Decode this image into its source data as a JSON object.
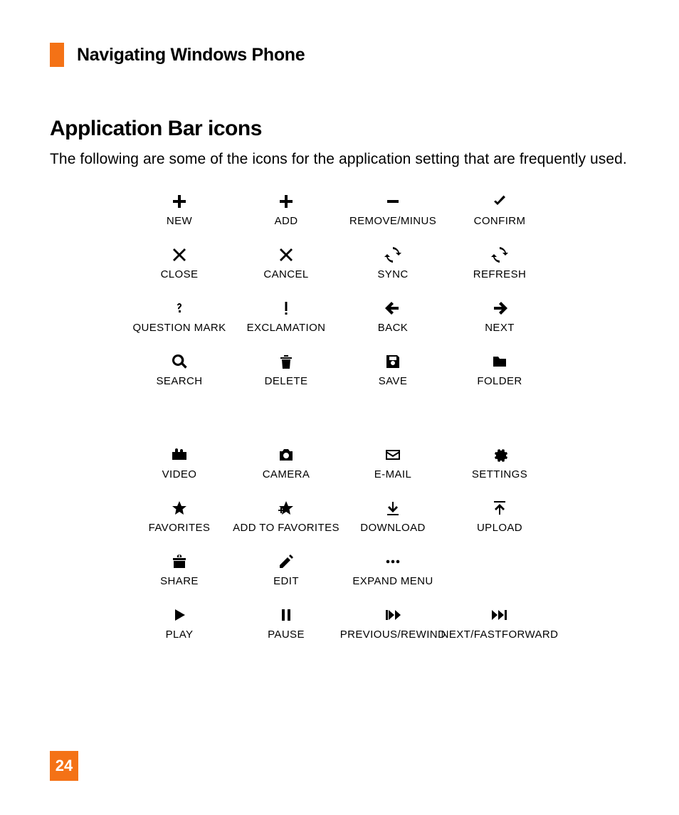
{
  "header": {
    "section_title": "Navigating Windows Phone"
  },
  "subtitle": "Application Bar icons",
  "intro": "The following are some of the icons for the application setting that are frequently used.",
  "page_number": "24",
  "icons": {
    "new": "NEW",
    "add": "ADD",
    "remove": "REMOVE/MINUS",
    "confirm": "CONFIRM",
    "close": "CLOSE",
    "cancel": "CANCEL",
    "sync": "SYNC",
    "refresh": "REFRESH",
    "question": "QUESTION MARK",
    "exclamation": "EXCLAMATION",
    "back": "BACK",
    "next": "NEXT",
    "search": "SEARCH",
    "delete": "DELETE",
    "save": "SAVE",
    "folder": "FOLDER",
    "video": "VIDEO",
    "camera": "CAMERA",
    "email": "E-MAIL",
    "settings": "SETTINGS",
    "favorites": "FAVORITES",
    "add_to_favorites": "ADD TO FAVORITES",
    "download": "DOWNLOAD",
    "upload": "UPLOAD",
    "share": "SHARE",
    "edit": "EDIT",
    "expand": "EXPAND MENU",
    "play": "PLAY",
    "pause": "PAUSE",
    "previous": "PREVIOUS/REWIND",
    "fastforward": "NEXT/FASTFORWARD"
  }
}
